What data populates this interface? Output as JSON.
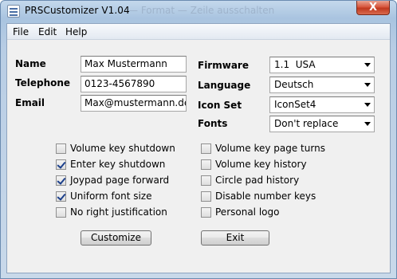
{
  "window": {
    "title": "PRSCustomizer V1.04",
    "title_ghost": "— Format — Zeile ausschalten",
    "close_label": "X"
  },
  "menu": [
    "File",
    "Edit",
    "Help"
  ],
  "fields": {
    "name": {
      "label": "Name",
      "value": "Max Mustermann"
    },
    "telephone": {
      "label": "Telephone",
      "value": "0123-4567890"
    },
    "email": {
      "label": "Email",
      "value": "Max@mustermann.de"
    }
  },
  "selects": {
    "firmware": {
      "label": "Firmware",
      "value": "1.1  USA"
    },
    "language": {
      "label": "Language",
      "value": "Deutsch"
    },
    "icon_set": {
      "label": "Icon Set",
      "value": "IconSet4"
    },
    "fonts": {
      "label": "Fonts",
      "value": "Don't replace"
    }
  },
  "checkboxes_left": [
    {
      "label": "Volume key shutdown",
      "checked": false
    },
    {
      "label": "Enter key shutdown",
      "checked": true
    },
    {
      "label": "Joypad page forward",
      "checked": true
    },
    {
      "label": "Uniform font size",
      "checked": true
    },
    {
      "label": "No right justification",
      "checked": false
    }
  ],
  "checkboxes_right": [
    {
      "label": "Volume key page turns",
      "checked": false
    },
    {
      "label": "Volume key history",
      "checked": false
    },
    {
      "label": "Circle pad history",
      "checked": false
    },
    {
      "label": "Disable number keys",
      "checked": false
    },
    {
      "label": "Personal logo",
      "checked": false
    }
  ],
  "buttons": {
    "customize": "Customize",
    "exit": "Exit"
  },
  "icons": {
    "app": "app-icon",
    "dropdown": "chevron-down-icon",
    "check": "checkmark-icon"
  },
  "colors": {
    "titlebar": "#a9c4e0",
    "close": "#c0391f",
    "client_bg": "#f0f0f0",
    "check_mark": "#1b3f8b"
  }
}
